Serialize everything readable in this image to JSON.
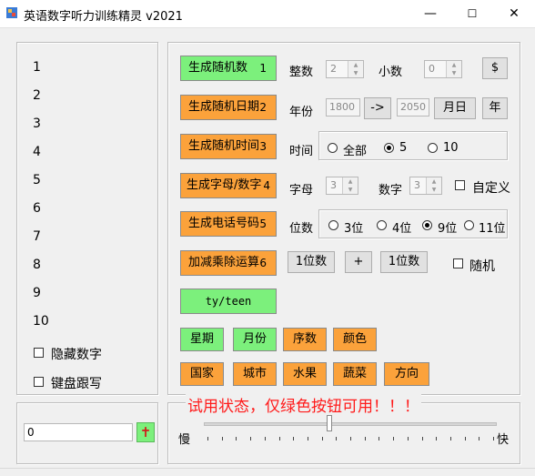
{
  "window": {
    "title": "英语数字听力训练精灵 v2021",
    "minimize": "—",
    "maximize": "☐",
    "close": "✕"
  },
  "numbers_list": [
    "1",
    "2",
    "3",
    "4",
    "5",
    "6",
    "7",
    "8",
    "9",
    "10"
  ],
  "checkboxes_left": {
    "hide_numbers": "隐藏数字",
    "keyboard_follow": "键盘跟写"
  },
  "input": {
    "value": "0",
    "add_button": "✝"
  },
  "buttons": {
    "gen_number": {
      "label": "生成随机数",
      "num": "1"
    },
    "gen_date": {
      "label": "生成随机日期",
      "num": "2"
    },
    "gen_time": {
      "label": "生成随机时间",
      "num": "3"
    },
    "gen_letter": {
      "label": "生成字母/数字",
      "num": "4"
    },
    "gen_phone": {
      "label": "生成电话号码",
      "num": "5"
    },
    "arith": {
      "label": "加减乘除运算",
      "num": "6"
    },
    "ty_teen": "ty/teen",
    "dollar": "$",
    "arrow": "->",
    "month_day": "月日",
    "year": "年",
    "digit1": "1位数",
    "plus": "+",
    "digit2": "1位数"
  },
  "labels": {
    "integer": "整数",
    "decimal": "小数",
    "year": "年份",
    "time": "时间",
    "letter": "字母",
    "digit": "数字",
    "custom": "自定义",
    "places": "位数",
    "random": "随机"
  },
  "spinners": {
    "integer": "2",
    "decimal": "0",
    "letter": "3",
    "digit": "3"
  },
  "year_range": {
    "from": "1800",
    "to": "2050"
  },
  "time_options": [
    "全部",
    "5",
    "10"
  ],
  "phone_options": [
    "3位",
    "4位",
    "9位",
    "11位"
  ],
  "category_buttons": [
    {
      "label": "星期",
      "color": "green"
    },
    {
      "label": "月份",
      "color": "green"
    },
    {
      "label": "序数",
      "color": "orange"
    },
    {
      "label": "颜色",
      "color": "orange"
    },
    {
      "label": "国家",
      "color": "orange"
    },
    {
      "label": "城市",
      "color": "orange"
    },
    {
      "label": "水果",
      "color": "orange"
    },
    {
      "label": "蔬菜",
      "color": "orange"
    },
    {
      "label": "方向",
      "color": "orange"
    }
  ],
  "trial_notice": "试用状态，仅绿色按钮可用！！！",
  "speed": {
    "slow": "慢",
    "fast": "快",
    "level": 0.42
  },
  "colors": {
    "green": "#7cf07c",
    "orange": "#fba23b",
    "notice": "#ff1a1a"
  }
}
